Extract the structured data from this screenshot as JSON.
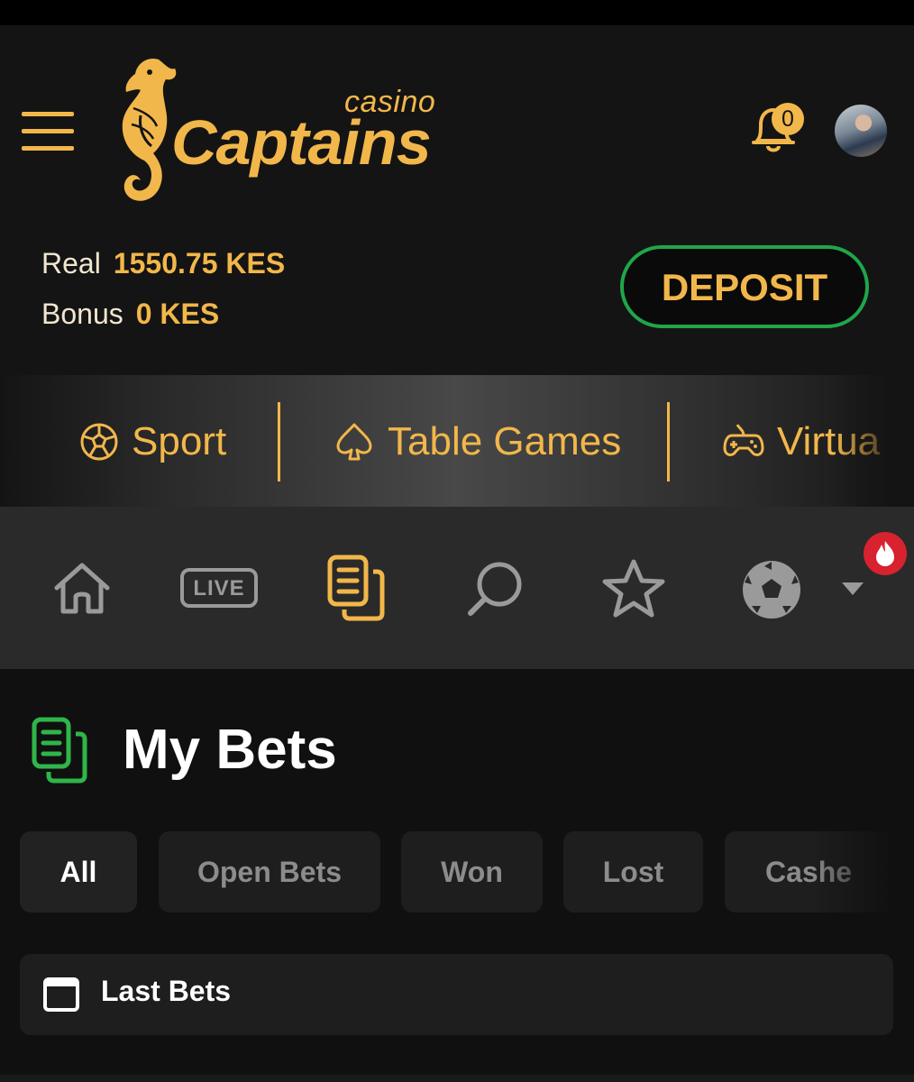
{
  "brand": {
    "casino_word": "casino",
    "name": "Captains",
    "accent_color": "#f2b74a",
    "deposit_border_color": "#1fa64a"
  },
  "header": {
    "notifications_count": "0",
    "deposit_label": "DEPOSIT"
  },
  "balances": [
    {
      "label": "Real",
      "value": "1550.75 KES"
    },
    {
      "label": "Bonus",
      "value": "0 KES"
    }
  ],
  "categories": [
    {
      "label": "Sport",
      "icon": "soccer-ball-icon"
    },
    {
      "label": "Table Games",
      "icon": "spade-icon"
    },
    {
      "label": "Virtua",
      "icon": "gamepad-icon"
    }
  ],
  "bottom_nav": {
    "items": [
      "home-icon",
      "live-icon",
      "my-bets-icon",
      "search-icon",
      "favorites-star-icon",
      "soccer-ball-icon",
      "dropdown-caret-icon"
    ],
    "live_label": "LIVE",
    "active": "my-bets-icon"
  },
  "page": {
    "title": "My Bets"
  },
  "filter_tabs": [
    {
      "label": "All",
      "active": true
    },
    {
      "label": "Open Bets",
      "active": false
    },
    {
      "label": "Won",
      "active": false
    },
    {
      "label": "Lost",
      "active": false
    },
    {
      "label": "Cashe",
      "active": false
    }
  ],
  "last_bets": {
    "label": "Last Bets"
  }
}
